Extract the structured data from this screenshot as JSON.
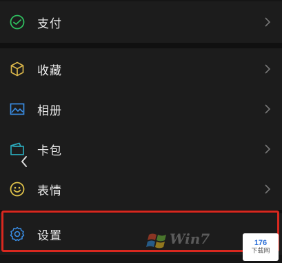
{
  "menu": {
    "items": [
      {
        "label": "支付",
        "icon": "wechat-pay-icon"
      },
      {
        "label": "收藏",
        "icon": "favorites-cube-icon"
      },
      {
        "label": "相册",
        "icon": "album-image-icon"
      },
      {
        "label": "卡包",
        "icon": "card-wallet-icon"
      },
      {
        "label": "表情",
        "icon": "smiley-icon"
      },
      {
        "label": "设置",
        "icon": "gear-icon"
      }
    ]
  },
  "colors": {
    "background": "#151515",
    "row": "#1c1c1c",
    "pay_icon": "#2fbf5f",
    "favorites_icon": "#d9b54a",
    "album_icon": "#3a8ee6",
    "card_icon": "#2aa7b8",
    "smiley_icon": "#e0c34a",
    "settings_icon": "#3a8ee6",
    "highlight": "#d8281f"
  },
  "watermark": {
    "text": "Win7",
    "logo_number": "176",
    "logo_subtitle": "下载网"
  }
}
